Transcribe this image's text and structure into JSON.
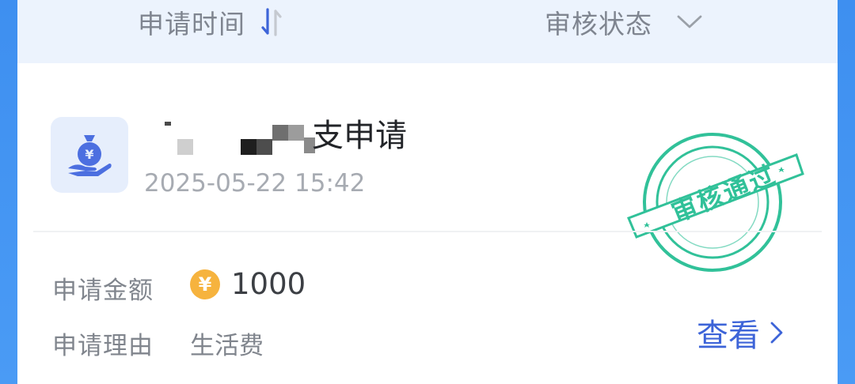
{
  "filters": {
    "time_label": "申请时间",
    "status_label": "审核状态",
    "time_icon": "sort-icon",
    "status_icon": "chevron-down-icon"
  },
  "application": {
    "icon": "money-bag-hand-icon",
    "title_visible": "支申请",
    "time": "2025-05-22 15:42",
    "stamp_text": "审核通过"
  },
  "details": {
    "amount_label": "申请金额",
    "amount_symbol": "¥",
    "amount_value": "1000",
    "reason_label": "申请理由",
    "reason_value": "生活费"
  },
  "actions": {
    "view_label": "查看"
  },
  "colors": {
    "accent": "#3d64d8",
    "stamp": "#31c199",
    "coin": "#f6b33e",
    "header_bg": "#ecf3fd"
  }
}
